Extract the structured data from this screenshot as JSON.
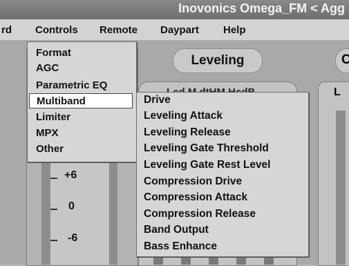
{
  "window": {
    "title": "Inovonics Omega_FM < Agg"
  },
  "menubar": {
    "items": [
      {
        "label": "rd"
      },
      {
        "label": "Controls"
      },
      {
        "label": "Remote"
      },
      {
        "label": "Daypart"
      },
      {
        "label": "Help"
      }
    ]
  },
  "controls_menu": {
    "items": [
      {
        "label": "Format"
      },
      {
        "label": "AGC"
      },
      {
        "label": "Parametric EQ"
      },
      {
        "label": "Multiband",
        "selected": true
      },
      {
        "label": "Limiter"
      },
      {
        "label": "MPX"
      },
      {
        "label": "Other"
      }
    ]
  },
  "multiband_submenu": {
    "items": [
      {
        "label": "Drive"
      },
      {
        "label": "Leveling Attack"
      },
      {
        "label": "Leveling Release"
      },
      {
        "label": "Leveling Gate Threshold"
      },
      {
        "label": "Leveling Gate Rest Level"
      },
      {
        "label": "Compression Drive"
      },
      {
        "label": "Compression Attack"
      },
      {
        "label": "Compression Release"
      },
      {
        "label": "Band Output"
      },
      {
        "label": "Bass Enhance"
      }
    ]
  },
  "leveling": {
    "title": "Leveling",
    "panel_header": "Lcd M dtHM HcdB"
  },
  "right_panel": {
    "label": "L",
    "pill_letter": "C"
  },
  "scale": {
    "labels": [
      "+6",
      "0",
      "-6"
    ]
  },
  "colors": {
    "menu_bg": "#d6d6d6",
    "title_bg": "#7a7a7a",
    "workspace": "#a9a9a9"
  }
}
